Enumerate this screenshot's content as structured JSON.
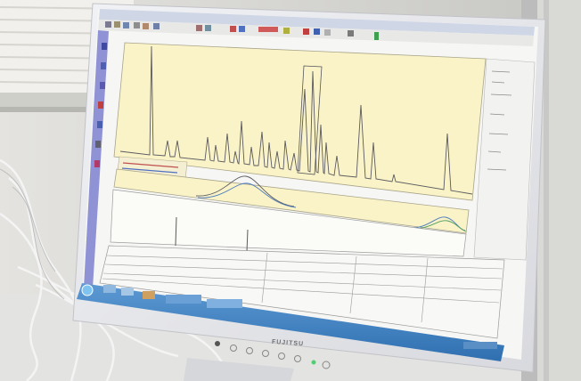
{
  "scene": {
    "description_colors": {
      "wall": "#d7d7d3",
      "blinds": "#ecebe6",
      "bezel": "#e9eaee",
      "screen_window": "#f6f6f4",
      "chart_background": "#faf3c7",
      "trace_line": "#5a5a60",
      "taskbar": "#3f83c4",
      "sidebar": "#8f92d4"
    }
  },
  "monitor": {
    "brand": "FUJITSU"
  }
}
